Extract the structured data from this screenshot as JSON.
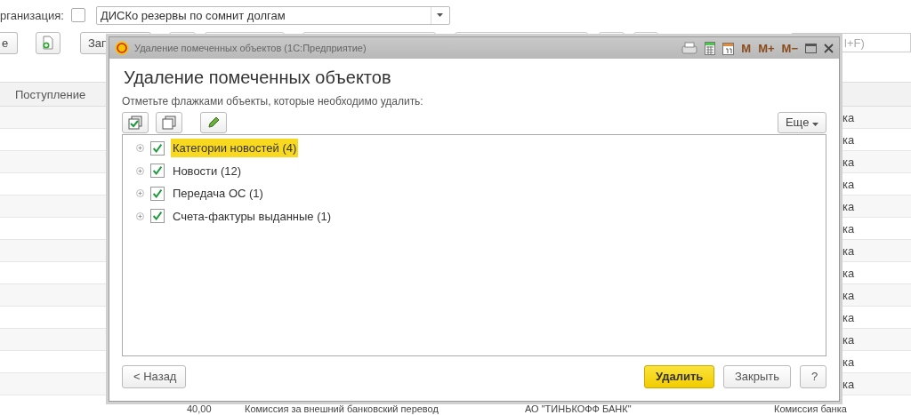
{
  "filter": {
    "label": "рганизация:",
    "checked": false,
    "value": "ДИСКо резервы по сомнит долгам"
  },
  "toolbar": {
    "buttons": [
      "е",
      "Зап"
    ],
    "search_placeholder": "l+F)"
  },
  "table": {
    "columns": [
      "Поступление"
    ],
    "rows": [
      {
        "operation": "ка"
      },
      {
        "operation": "ка"
      },
      {
        "operation": "ка"
      },
      {
        "operation": "ка"
      },
      {
        "operation": "ка"
      },
      {
        "operation": "ка"
      },
      {
        "operation": "ка"
      },
      {
        "operation": "ка"
      },
      {
        "operation": "ка"
      },
      {
        "operation": "ка"
      },
      {
        "operation": "ка"
      },
      {
        "operation": "ка"
      },
      {
        "operation": "ка"
      }
    ],
    "last_row": {
      "amount": "40,00",
      "purpose": "Комиссия за внешний банковский перевод",
      "counterparty": "АО \"ТИНЬКОФФ БАНК\"",
      "operation": "Комиссия банка"
    }
  },
  "dialog": {
    "title": "Удаление помеченных объектов  (1С:Предприятие)",
    "memory_buttons": [
      "M",
      "M+",
      "M−"
    ],
    "heading": "Удаление помеченных объектов",
    "instruction": "Отметьте флажками объекты, которые необходимо удалить:",
    "more_button": "Еще",
    "items": [
      {
        "label": "Категории новостей (4)",
        "checked": true,
        "selected": true
      },
      {
        "label": "Новости (12)",
        "checked": true,
        "selected": false
      },
      {
        "label": "Передача ОС (1)",
        "checked": true,
        "selected": false
      },
      {
        "label": "Счета-фактуры выданные (1)",
        "checked": true,
        "selected": false
      }
    ],
    "buttons": [
      {
        "label": "< Назад",
        "kind": "normal"
      },
      {
        "label": "Удалить",
        "kind": "default"
      },
      {
        "label": "Закрыть",
        "kind": "normal"
      },
      {
        "label": "?",
        "kind": "normal"
      }
    ]
  }
}
